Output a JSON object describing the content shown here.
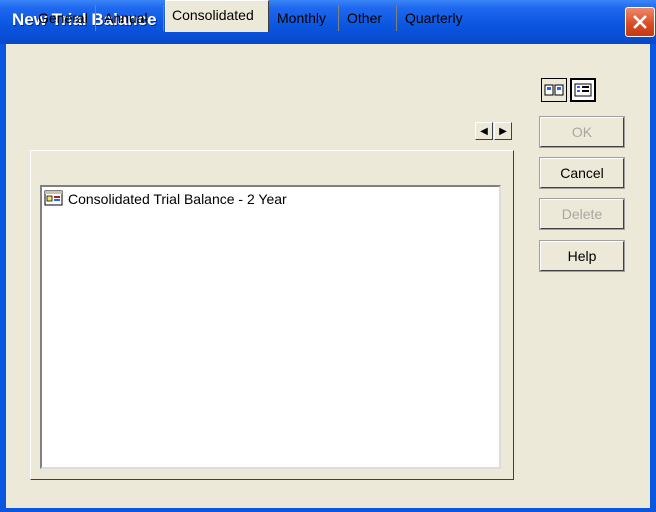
{
  "window": {
    "title": "New Trial Balance"
  },
  "tabs": [
    {
      "label": "General"
    },
    {
      "label": "Annual"
    },
    {
      "label": "Consolidated"
    },
    {
      "label": "Monthly"
    },
    {
      "label": "Other"
    },
    {
      "label": "Quarterly"
    }
  ],
  "selected_tab": "Consolidated",
  "list": {
    "items": [
      {
        "label": "Consolidated Trial Balance - 2 Year",
        "icon": "document-icon"
      }
    ]
  },
  "buttons": {
    "ok": "OK",
    "cancel": "Cancel",
    "delete": "Delete",
    "help": "Help"
  },
  "toolbar": {
    "large_icons_view": "large-icons-view-icon",
    "list_view": "list-view-icon"
  },
  "colors": {
    "titlebar": "#0a55e0",
    "close_button": "#d84a22",
    "dialog_background": "#ece9d8"
  }
}
